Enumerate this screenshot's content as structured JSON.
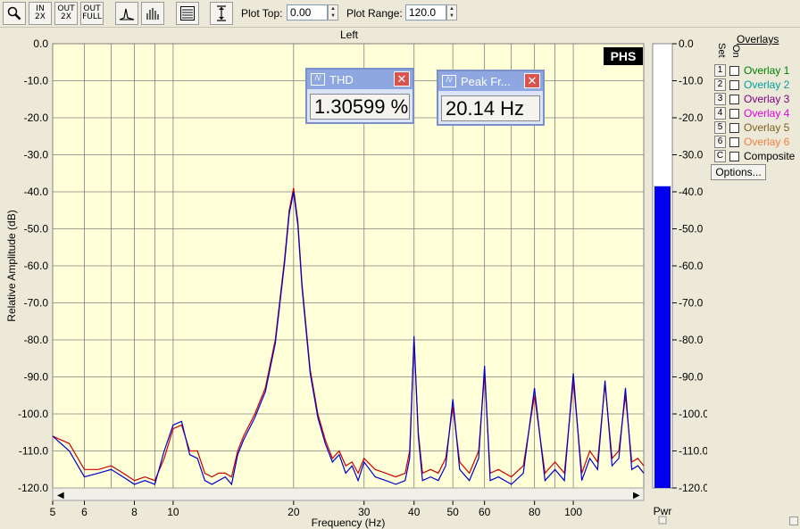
{
  "toolbar": {
    "zoom_in_label": "IN 2X",
    "zoom_out_label": "OUT 2X",
    "zoom_full_label": "OUT FULL",
    "plot_top_label": "Plot Top:",
    "plot_top_value": "0.00",
    "plot_range_label": "Plot Range:",
    "plot_range_value": "120.0"
  },
  "popups": {
    "thd": {
      "title": "THD",
      "value": "1.30599 %"
    },
    "peak": {
      "title": "Peak Fr...",
      "value": "20.14 Hz"
    }
  },
  "watermark": "PHS",
  "overlays": {
    "header": "Overlays",
    "set_label": "Set",
    "on_label": "On",
    "items": [
      {
        "set": "1",
        "label": "Overlay 1",
        "color": "#008000"
      },
      {
        "set": "2",
        "label": "Overlay 2",
        "color": "#00a0a0"
      },
      {
        "set": "3",
        "label": "Overlay 3",
        "color": "#800080"
      },
      {
        "set": "4",
        "label": "Overlay 4",
        "color": "#e000e0"
      },
      {
        "set": "5",
        "label": "Overlay 5",
        "color": "#806020"
      },
      {
        "set": "6",
        "label": "Overlay 6",
        "color": "#f08040"
      }
    ],
    "composite_set": "C",
    "composite_label": "Composite",
    "options_label": "Options..."
  },
  "power_meter": {
    "label": "Pwr",
    "level_db": -38.5,
    "color": "#0000ee"
  },
  "chart_data": {
    "type": "line",
    "title": "Left",
    "xlabel": "Frequency (Hz)",
    "ylabel": "Relative Amplitude (dB)",
    "x_scale": "log",
    "xlim": [
      5,
      150
    ],
    "ylim": [
      -120,
      0
    ],
    "x_ticks": [
      5,
      6,
      8,
      10,
      20,
      30,
      40,
      50,
      60,
      80,
      100
    ],
    "y_ticks": [
      "0.0",
      "-10.0",
      "-20.0",
      "-30.0",
      "-40.0",
      "-50.0",
      "-60.0",
      "-70.0",
      "-80.0",
      "-90.0",
      "-100.0",
      "-110.0",
      "-120.0"
    ],
    "right_y_ticks": [
      "0.0",
      "-10.0",
      "-20.0",
      "-30.0",
      "-40.0",
      "-50.0",
      "-60.0",
      "-70.0",
      "-80.0",
      "-90.0",
      "-100.0",
      "-110.0",
      "-120.0"
    ],
    "grid": true,
    "background": "#ffffd8",
    "series": [
      {
        "color": "#cc0000",
        "x": [
          5,
          5.5,
          6,
          6.5,
          7,
          7.5,
          8,
          8.5,
          9,
          9.5,
          10,
          10.5,
          11,
          11.5,
          12,
          12.5,
          13,
          13.5,
          14,
          14.5,
          15,
          16,
          17,
          18,
          19,
          19.5,
          20,
          20.5,
          21,
          22,
          23,
          24,
          25,
          26,
          27,
          28,
          29,
          30,
          32,
          34,
          36,
          38,
          39,
          40,
          41,
          42,
          44,
          46,
          48,
          50,
          52,
          55,
          58,
          60,
          62,
          65,
          70,
          75,
          80,
          85,
          90,
          95,
          100,
          105,
          110,
          115,
          120,
          125,
          130,
          135,
          140,
          145,
          150
        ],
        "y": [
          -106,
          -108,
          -115,
          -115,
          -114,
          -116,
          -118,
          -117,
          -118,
          -112,
          -104,
          -103,
          -110,
          -110,
          -116,
          -117,
          -116,
          -116,
          -117,
          -110,
          -106,
          -100,
          -93,
          -80,
          -58,
          -45,
          -39,
          -48,
          -65,
          -88,
          -100,
          -107,
          -112,
          -110,
          -114,
          -113,
          -116,
          -112,
          -115,
          -116,
          -117,
          -116,
          -110,
          -80,
          -105,
          -116,
          -115,
          -116,
          -112,
          -98,
          -113,
          -116,
          -110,
          -89,
          -116,
          -115,
          -117,
          -114,
          -95,
          -116,
          -113,
          -116,
          -91,
          -116,
          -110,
          -113,
          -92,
          -112,
          -110,
          -95,
          -113,
          -112,
          -114
        ]
      },
      {
        "color": "#0000cc",
        "x": [
          5,
          5.5,
          6,
          6.5,
          7,
          7.5,
          8,
          8.5,
          9,
          9.5,
          10,
          10.5,
          11,
          11.5,
          12,
          12.5,
          13,
          13.5,
          14,
          14.5,
          15,
          16,
          17,
          18,
          19,
          19.5,
          20,
          20.5,
          21,
          22,
          23,
          24,
          25,
          26,
          27,
          28,
          29,
          30,
          32,
          34,
          36,
          38,
          39,
          40,
          41,
          42,
          44,
          46,
          48,
          50,
          52,
          55,
          58,
          60,
          62,
          65,
          70,
          75,
          80,
          85,
          90,
          95,
          100,
          105,
          110,
          115,
          120,
          125,
          130,
          135,
          140,
          145,
          150
        ],
        "y": [
          -106,
          -110,
          -117,
          -116,
          -115,
          -117,
          -119,
          -118,
          -119,
          -110,
          -103,
          -102,
          -111,
          -112,
          -118,
          -119,
          -118,
          -117,
          -119,
          -111,
          -107,
          -101,
          -94,
          -81,
          -59,
          -46,
          -40,
          -49,
          -66,
          -89,
          -101,
          -108,
          -113,
          -111,
          -116,
          -114,
          -118,
          -113,
          -117,
          -118,
          -119,
          -118,
          -112,
          -79,
          -106,
          -118,
          -117,
          -118,
          -114,
          -96,
          -115,
          -118,
          -112,
          -87,
          -118,
          -117,
          -119,
          -116,
          -93,
          -118,
          -115,
          -118,
          -89,
          -118,
          -112,
          -115,
          -91,
          -114,
          -112,
          -93,
          -115,
          -114,
          -116
        ]
      }
    ]
  }
}
